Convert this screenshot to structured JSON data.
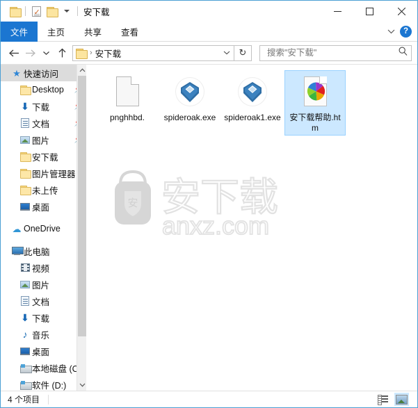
{
  "window": {
    "title": "安下载",
    "quick_access_toolbar": [
      {
        "name": "folder-icon",
        "tooltip": "属性"
      },
      {
        "name": "properties-icon",
        "tooltip": "属性"
      },
      {
        "name": "new-folder-icon",
        "tooltip": "新建文件夹"
      },
      {
        "name": "chevron-down-icon",
        "tooltip": "自定义快速访问工具栏"
      }
    ],
    "controls": {
      "minimize": "minimize-icon",
      "maximize": "maximize-icon",
      "close": "close-icon"
    }
  },
  "ribbon": {
    "tabs": [
      {
        "label": "文件",
        "active": true
      },
      {
        "label": "主页",
        "active": false
      },
      {
        "label": "共享",
        "active": false
      },
      {
        "label": "查看",
        "active": false
      }
    ],
    "collapse_icon": "chevron-down-icon",
    "help_icon": "help-icon",
    "help_label": "?"
  },
  "address_bar": {
    "back_icon": "arrow-left-icon",
    "forward_icon": "arrow-right-icon",
    "recent_icon": "chevron-down-icon",
    "up_icon": "arrow-up-icon",
    "breadcrumb_icon": "folder-icon",
    "breadcrumb_separator": "›",
    "breadcrumb": "安下载",
    "dropdown_icon": "chevron-down-icon",
    "refresh_icon": "refresh-icon",
    "refresh_glyph": "↻"
  },
  "search": {
    "placeholder": "搜索\"安下载\"",
    "value": "",
    "icon": "search-icon"
  },
  "sidebar": {
    "items": [
      {
        "label": "快速访问",
        "icon": "star-icon",
        "indent": 0,
        "selected": true,
        "pinned": false
      },
      {
        "label": "Desktop",
        "icon": "folder-icon",
        "indent": 1,
        "selected": false,
        "pinned": true
      },
      {
        "label": "下载",
        "icon": "download-icon",
        "indent": 1,
        "selected": false,
        "pinned": true
      },
      {
        "label": "文档",
        "icon": "documents-icon",
        "indent": 1,
        "selected": false,
        "pinned": true
      },
      {
        "label": "图片",
        "icon": "pictures-icon",
        "indent": 1,
        "selected": false,
        "pinned": true
      },
      {
        "label": "安下载",
        "icon": "folder-icon",
        "indent": 1,
        "selected": false,
        "pinned": false
      },
      {
        "label": "图片管理器",
        "icon": "folder-icon",
        "indent": 1,
        "selected": false,
        "pinned": false
      },
      {
        "label": "未上传",
        "icon": "folder-icon",
        "indent": 1,
        "selected": false,
        "pinned": false
      },
      {
        "label": "桌面",
        "icon": "desktop-icon",
        "indent": 1,
        "selected": false,
        "pinned": false
      },
      {
        "label": "OneDrive",
        "icon": "cloud-icon",
        "indent": 0,
        "selected": false,
        "pinned": false
      },
      {
        "label": "此电脑",
        "icon": "computer-icon",
        "indent": 0,
        "selected": false,
        "pinned": false
      },
      {
        "label": "视频",
        "icon": "video-icon",
        "indent": 1,
        "selected": false,
        "pinned": false
      },
      {
        "label": "图片",
        "icon": "pictures-icon",
        "indent": 1,
        "selected": false,
        "pinned": false
      },
      {
        "label": "文档",
        "icon": "documents-icon",
        "indent": 1,
        "selected": false,
        "pinned": false
      },
      {
        "label": "下载",
        "icon": "download-icon",
        "indent": 1,
        "selected": false,
        "pinned": false
      },
      {
        "label": "音乐",
        "icon": "music-icon",
        "indent": 1,
        "selected": false,
        "pinned": false
      },
      {
        "label": "桌面",
        "icon": "desktop-icon",
        "indent": 1,
        "selected": false,
        "pinned": false
      },
      {
        "label": "本地磁盘 (C",
        "icon": "drive-icon",
        "indent": 1,
        "selected": false,
        "pinned": false
      },
      {
        "label": "软件 (D:)",
        "icon": "drive-icon",
        "indent": 1,
        "selected": false,
        "pinned": false
      }
    ],
    "pin_glyph": "📌",
    "scrollbar": {
      "up_icon": "chevron-up-icon",
      "down_icon": "chevron-down-icon"
    }
  },
  "files": [
    {
      "name": "pnghhbd.",
      "icon": "blank-document-icon",
      "selected": false
    },
    {
      "name": "spideroak.exe",
      "icon": "spideroak-icon",
      "selected": false
    },
    {
      "name": "spideroak1.exe",
      "icon": "spideroak-icon",
      "selected": false
    },
    {
      "name": "安下载帮助.htm",
      "icon": "html-document-icon",
      "selected": true
    }
  ],
  "watermark": {
    "text": "安下载",
    "url": "anxz.com",
    "logo_char": "安"
  },
  "status_bar": {
    "item_count": "4 个项目",
    "views": [
      {
        "name": "details-view-button",
        "active": false
      },
      {
        "name": "large-icons-view-button",
        "active": true
      }
    ]
  },
  "colors": {
    "accent": "#1b76d1",
    "selection": "#cce8ff",
    "window_border": "#4a9fd4",
    "folder_yellow": "#fde7a8"
  }
}
